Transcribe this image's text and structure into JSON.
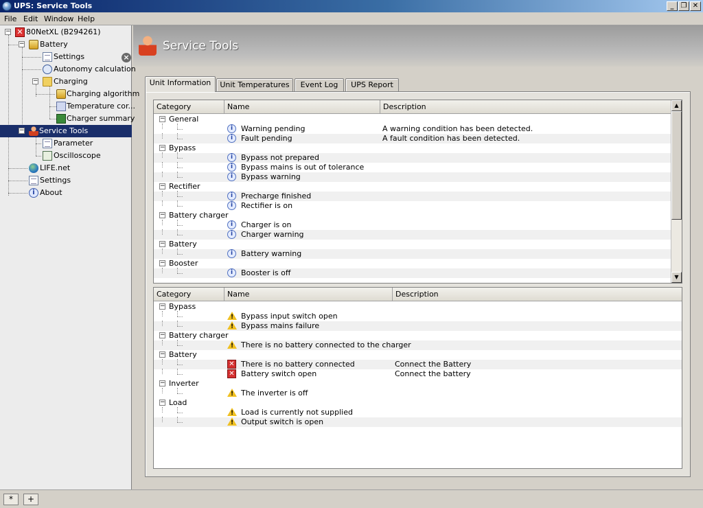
{
  "window": {
    "title": "UPS: Service Tools",
    "controls": {
      "minimize": "_",
      "restore": "❐",
      "close": "✕"
    }
  },
  "menu": [
    "File",
    "Edit",
    "Window",
    "Help"
  ],
  "tree": {
    "root": "80NetXL (B294261)",
    "battery": "Battery",
    "settings": "Settings",
    "autonomy": "Autonomy calculation",
    "charging": "Charging",
    "charging_algorithm": "Charging algorithm",
    "temperature": "Temperature cor...",
    "charger_summary": "Charger summary",
    "service_tools": "Service Tools",
    "parameter": "Parameter",
    "oscilloscope": "Oscilloscope",
    "lifenet": "LIFE.net",
    "settings2": "Settings",
    "about": "About"
  },
  "header": {
    "title": "Service Tools"
  },
  "tabs": [
    "Unit Information",
    "Unit Temperatures",
    "Event Log",
    "UPS Report"
  ],
  "top_grid": {
    "columns": [
      "Category",
      "Name",
      "Description"
    ],
    "rows": [
      {
        "type": "cat",
        "label": "General"
      },
      {
        "type": "item",
        "icon": "info",
        "name": "Warning pending",
        "desc": "A warning condition has been detected."
      },
      {
        "type": "item",
        "icon": "info",
        "name": "Fault pending",
        "desc": "A fault condition has been detected."
      },
      {
        "type": "cat",
        "label": "Bypass"
      },
      {
        "type": "item",
        "icon": "info",
        "name": "Bypass not prepared",
        "desc": ""
      },
      {
        "type": "item",
        "icon": "info",
        "name": "Bypass mains is out of tolerance",
        "desc": ""
      },
      {
        "type": "item",
        "icon": "info",
        "name": "Bypass warning",
        "desc": ""
      },
      {
        "type": "cat",
        "label": "Rectifier"
      },
      {
        "type": "item",
        "icon": "info",
        "name": "Precharge finished",
        "desc": ""
      },
      {
        "type": "item",
        "icon": "info",
        "name": "Rectifier is on",
        "desc": ""
      },
      {
        "type": "cat",
        "label": "Battery charger"
      },
      {
        "type": "item",
        "icon": "info",
        "name": "Charger is on",
        "desc": ""
      },
      {
        "type": "item",
        "icon": "info",
        "name": "Charger warning",
        "desc": ""
      },
      {
        "type": "cat",
        "label": "Battery"
      },
      {
        "type": "item",
        "icon": "info",
        "name": "Battery warning",
        "desc": ""
      },
      {
        "type": "cat",
        "label": "Booster"
      },
      {
        "type": "item",
        "icon": "info",
        "name": "Booster is off",
        "desc": ""
      }
    ]
  },
  "bottom_grid": {
    "columns": [
      "Category",
      "Name",
      "Description"
    ],
    "rows": [
      {
        "type": "cat",
        "label": "Bypass"
      },
      {
        "type": "item",
        "icon": "warn",
        "name": "Bypass input switch open",
        "desc": ""
      },
      {
        "type": "item",
        "icon": "warn",
        "name": "Bypass mains failure",
        "desc": ""
      },
      {
        "type": "cat",
        "label": "Battery charger"
      },
      {
        "type": "item",
        "icon": "warn",
        "name": "There is no battery connected to the charger",
        "desc": ""
      },
      {
        "type": "cat",
        "label": "Battery"
      },
      {
        "type": "item",
        "icon": "err",
        "name": "There is no battery connected",
        "desc": "Connect the Battery"
      },
      {
        "type": "item",
        "icon": "err",
        "name": "Battery switch open",
        "desc": "Connect the battery"
      },
      {
        "type": "cat",
        "label": "Inverter"
      },
      {
        "type": "item",
        "icon": "warn",
        "name": "The inverter is off",
        "desc": ""
      },
      {
        "type": "cat",
        "label": "Load"
      },
      {
        "type": "item",
        "icon": "warn",
        "name": "Load is currently not supplied",
        "desc": ""
      },
      {
        "type": "item",
        "icon": "warn",
        "name": "Output switch is open",
        "desc": ""
      }
    ]
  },
  "statusbar": {
    "btn1": "*",
    "btn2": "+"
  },
  "colors": {
    "selection": "#1a2e6a",
    "accent": "#0a246a"
  }
}
